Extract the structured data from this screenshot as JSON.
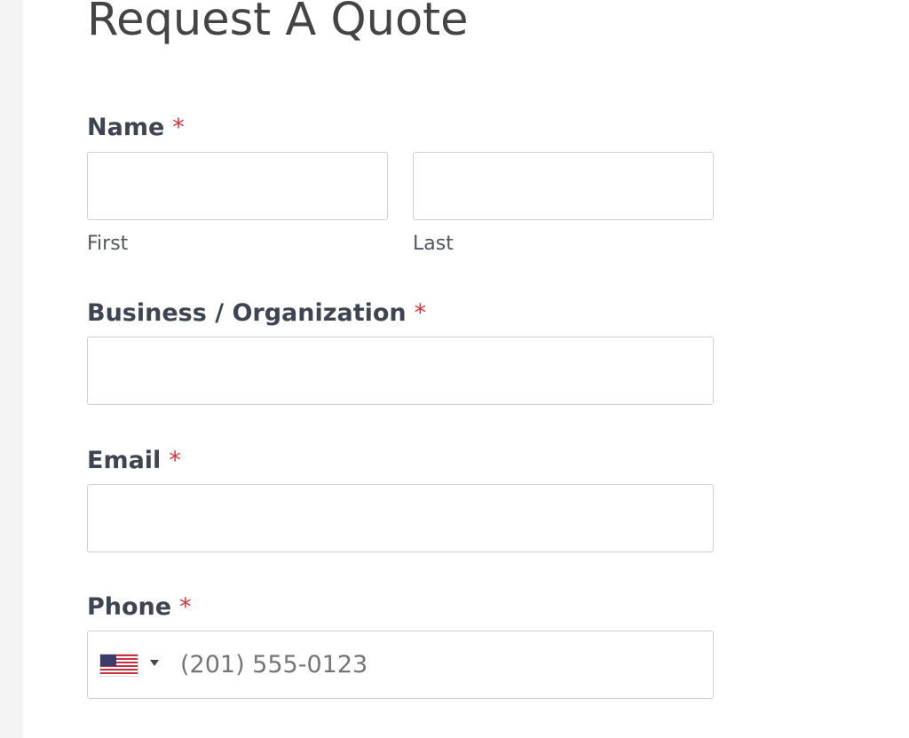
{
  "form": {
    "title": "Request A Quote",
    "required_marker": "*",
    "name": {
      "label": "Name",
      "first_sublabel": "First",
      "last_sublabel": "Last",
      "first_value": "",
      "last_value": ""
    },
    "business": {
      "label": "Business / Organization",
      "value": ""
    },
    "email": {
      "label": "Email",
      "value": ""
    },
    "phone": {
      "label": "Phone",
      "value": "",
      "placeholder": "(201) 555-0123",
      "country_flag_icon": "us-flag-icon",
      "dropdown_icon": "caret-down-icon"
    }
  },
  "colors": {
    "required": "#d63638",
    "label": "#3e4552",
    "border": "#cfcfcf",
    "sidebar": "#f4f4f4"
  }
}
